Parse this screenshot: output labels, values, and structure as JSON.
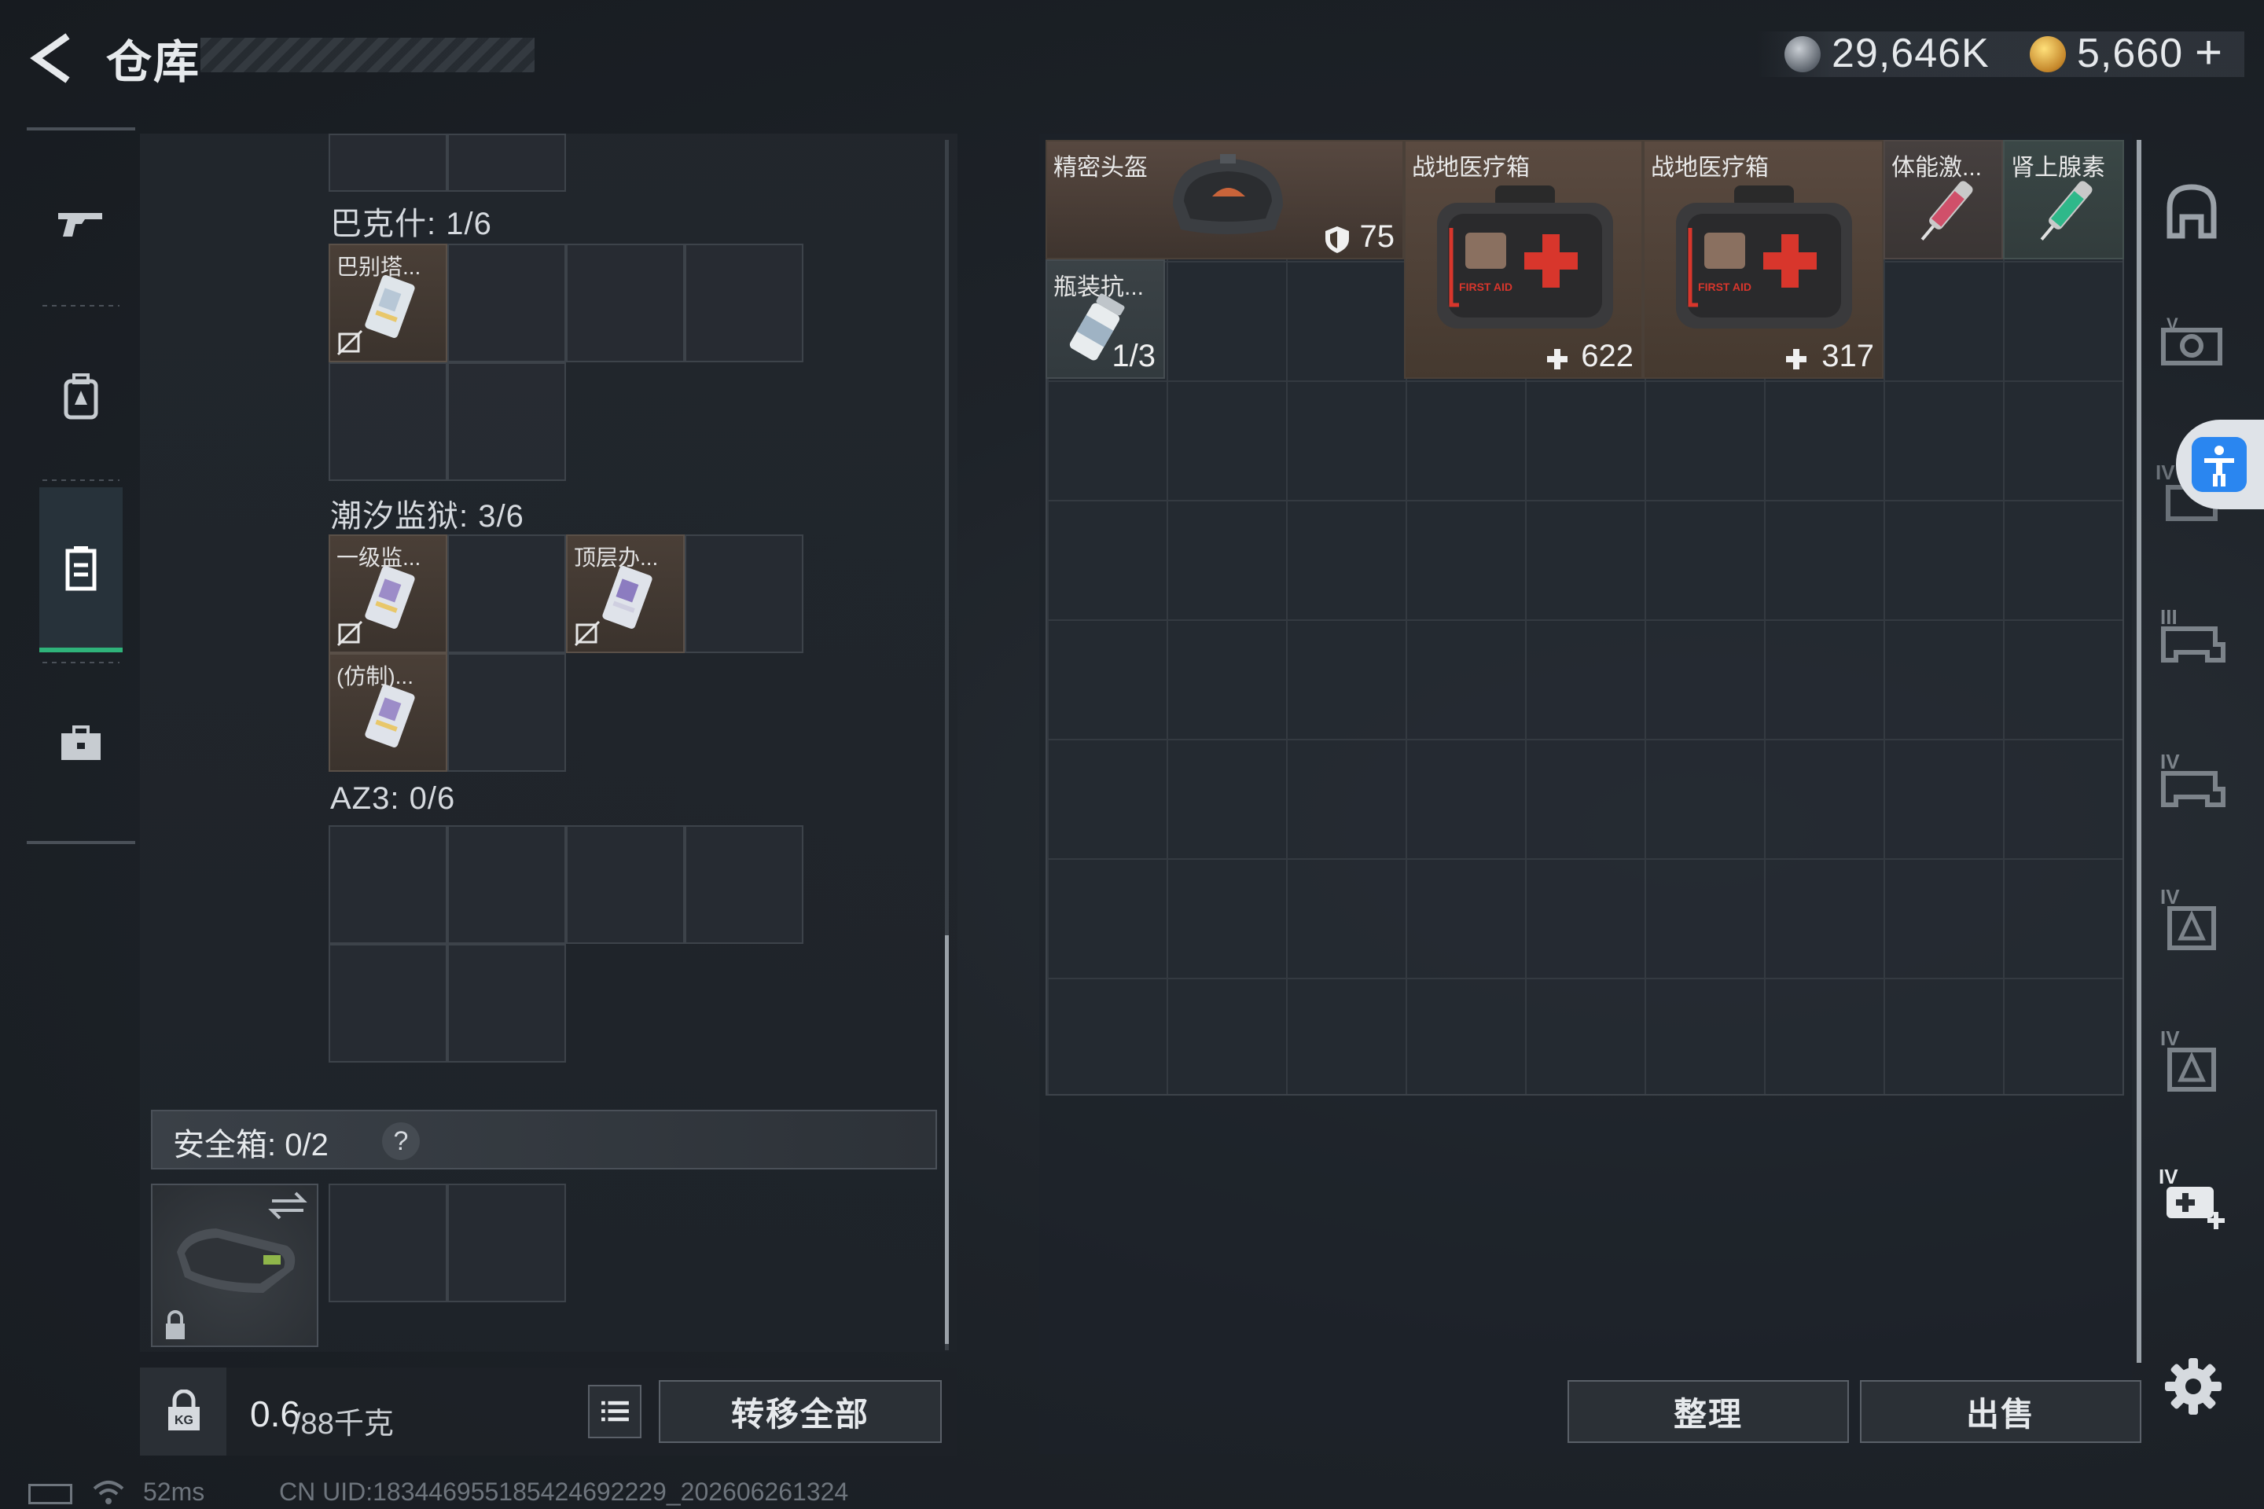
{
  "header": {
    "title": "仓库",
    "currency": [
      {
        "icon": "silver-coin-icon",
        "value": "29,646K",
        "color": "#c9ced4"
      },
      {
        "icon": "gold-coin-icon",
        "value": "5,660",
        "plus": "+",
        "color": "#e6a63a"
      }
    ]
  },
  "left_nav": {
    "items": [
      {
        "icon": "gun-icon",
        "active": false
      },
      {
        "icon": "backpack-icon",
        "active": false
      },
      {
        "icon": "container-icon",
        "active": true
      },
      {
        "icon": "toolbox-icon",
        "active": false
      }
    ],
    "active_color": "#2fb37a"
  },
  "containers": [
    {
      "label": "巴克什: 1/6",
      "items": [
        {
          "name": "巴别塔...",
          "icon": "keycard-icon"
        }
      ]
    },
    {
      "label": "潮汐监狱: 3/6",
      "items": [
        {
          "name": "一级监...",
          "icon": "keycard-icon"
        },
        {
          "name": "顶层办...",
          "icon": "keycard-icon"
        },
        {
          "name": "(仿制)...",
          "icon": "keycard-icon"
        }
      ]
    },
    {
      "label": "AZ3: 0/6",
      "items": []
    }
  ],
  "safe_box": {
    "label": "安全箱: 0/2",
    "help": "?"
  },
  "weight": {
    "current": "0.6",
    "max": "/88千克"
  },
  "buttons": {
    "transfer_all": "转移全部",
    "sort": "整理",
    "sell": "出售"
  },
  "stash_items": [
    {
      "name": "精密头盔",
      "icon": "helmet-icon",
      "value": "75",
      "value_icon": "armor-icon"
    },
    {
      "name": "战地医疗箱",
      "icon": "first-aid-kit-icon",
      "value": "622",
      "value_icon": "plus-icon",
      "kit_text": "FIRST AID"
    },
    {
      "name": "战地医疗箱",
      "icon": "first-aid-kit-icon",
      "value": "317",
      "value_icon": "plus-icon",
      "kit_text": "FIRST AID"
    },
    {
      "name": "体能激...",
      "icon": "syringe-icon",
      "color": "#d0506a"
    },
    {
      "name": "肾上腺素",
      "icon": "syringe-icon",
      "color": "#2fb88a"
    },
    {
      "name": "瓶装抗...",
      "icon": "pill-bottle-icon",
      "value": "1/3"
    }
  ],
  "right_filters": [
    "helmet-filter-icon",
    "armor-filter-icon",
    "tier5-filter-icon",
    "tier3-filter-icon",
    "tier4-filter-icon",
    "tier4-bag-filter-icon",
    "tier4-rig-filter-icon",
    "tier4-medical-filter-icon"
  ],
  "filter_labels": {
    "f5": "V",
    "f3": "III",
    "f4a": "IV",
    "f4b": "IV",
    "f4c": "IV",
    "f4d": "IV"
  },
  "status": {
    "ping": "52ms",
    "uid": "CN UID:18344695518542469222​9_202606261324"
  }
}
